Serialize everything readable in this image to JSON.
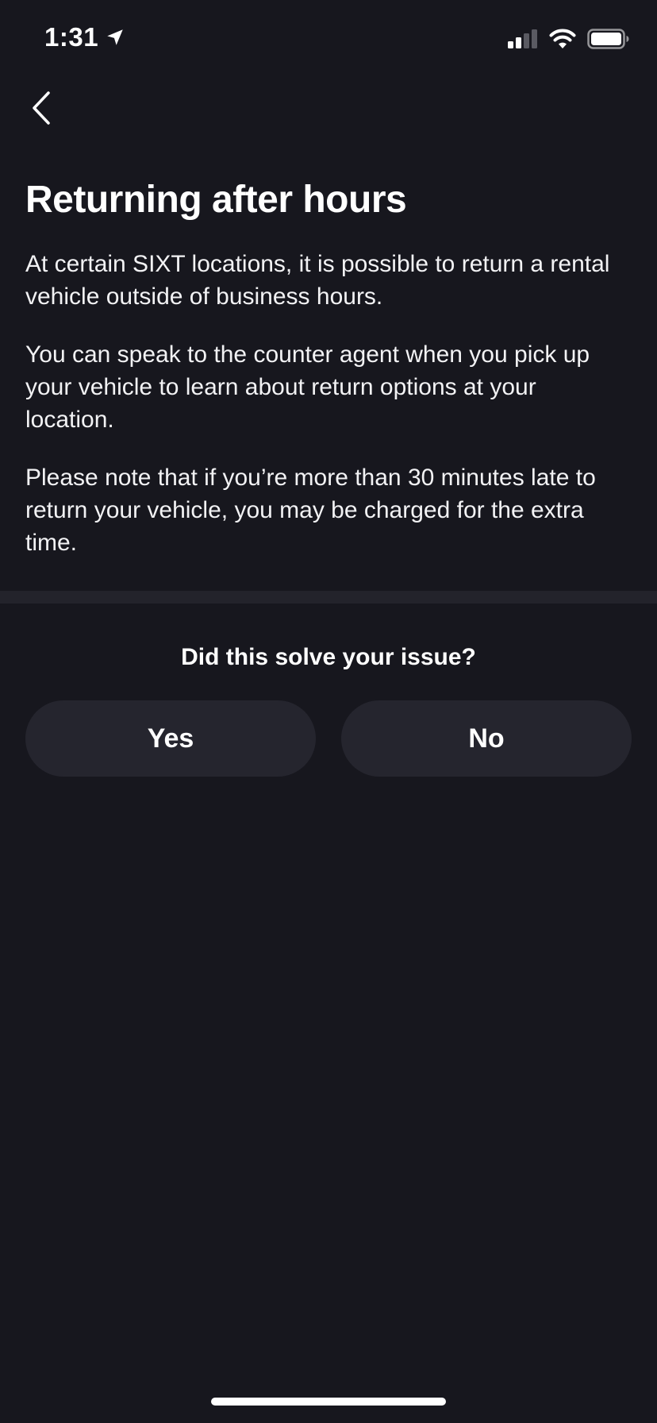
{
  "status_bar": {
    "time": "1:31",
    "icons": [
      "location-arrow-icon",
      "cellular-signal-icon",
      "wifi-icon",
      "battery-icon"
    ]
  },
  "nav": {
    "back_icon": "chevron-left-icon"
  },
  "article": {
    "title": "Returning after hours",
    "paragraphs": [
      "At certain SIXT locations, it is possible to return a rental vehicle outside of business hours.",
      "You can speak to the counter agent when you pick up your vehicle to learn about return options at your location.",
      "Please note that if you’re more than 30 minutes late to return your vehicle, you may be charged for the extra time."
    ]
  },
  "feedback": {
    "question": "Did this solve your issue?",
    "yes_label": "Yes",
    "no_label": "No"
  },
  "colors": {
    "background": "#17171e",
    "divider": "#23232b",
    "button": "#25252e",
    "text": "#ffffff"
  }
}
